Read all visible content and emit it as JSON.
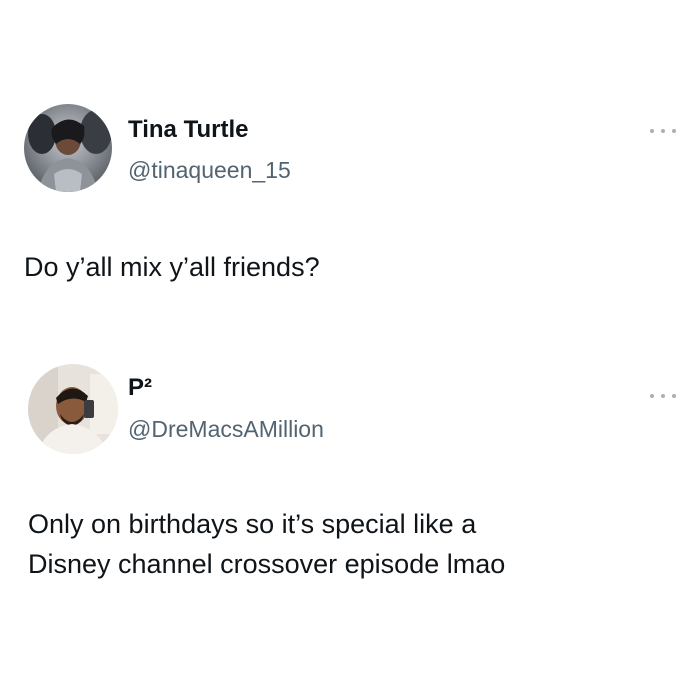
{
  "posts": [
    {
      "display_name": "Tina Turtle",
      "handle": "@tinaqueen_15",
      "text": "Do y’all mix y’all friends?",
      "avatar_icon": "user-avatar-photo-icon"
    },
    {
      "display_name": "P²",
      "handle": "@DreMacsAMillion",
      "text": "Only on birthdays so it’s special like a\nDisney channel crossover episode lmao",
      "avatar_icon": "user-avatar-photo-icon"
    }
  ],
  "colors": {
    "text_primary": "#0f1419",
    "text_secondary": "#536471",
    "more_dots": "#a7b1b9",
    "background": "#ffffff"
  }
}
